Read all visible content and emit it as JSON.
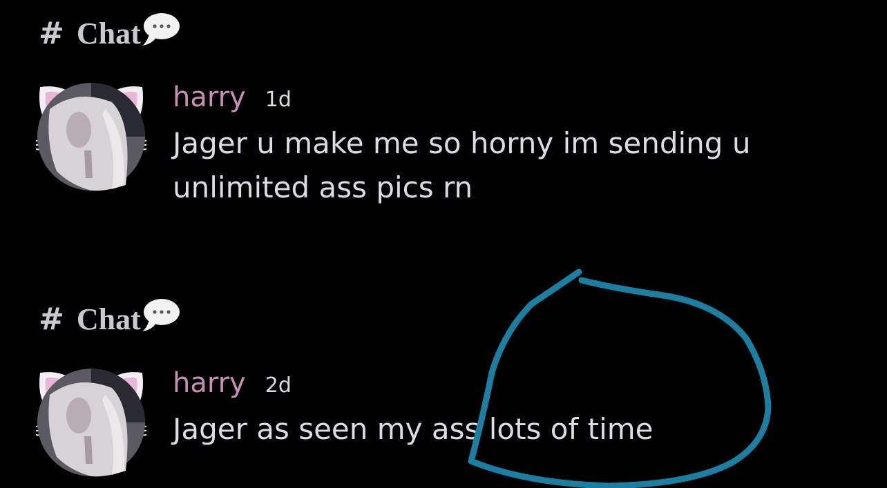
{
  "colors": {
    "background": "#000000",
    "username": "#c78fb6",
    "message_text": "#dcdde3",
    "channel_text": "#c9cad0",
    "annotation_stroke": "#1a7fa0"
  },
  "icons": {
    "channel": "hash-icon",
    "bubble": "speech-bubble-icon",
    "avatar": "avatar-with-cat-ears"
  },
  "groups": [
    {
      "channel": {
        "hash": "#",
        "name": "Chat"
      },
      "message": {
        "username": "harry",
        "timestamp": "1d",
        "lines": [
          "Jager u make me so horny im sending u",
          "unlimited ass pics rn"
        ]
      }
    },
    {
      "channel": {
        "hash": "#",
        "name": "Chat"
      },
      "message": {
        "username": "harry",
        "timestamp": "2d",
        "lines": [
          "Jager as seen my ass lots of time"
        ]
      }
    }
  ]
}
